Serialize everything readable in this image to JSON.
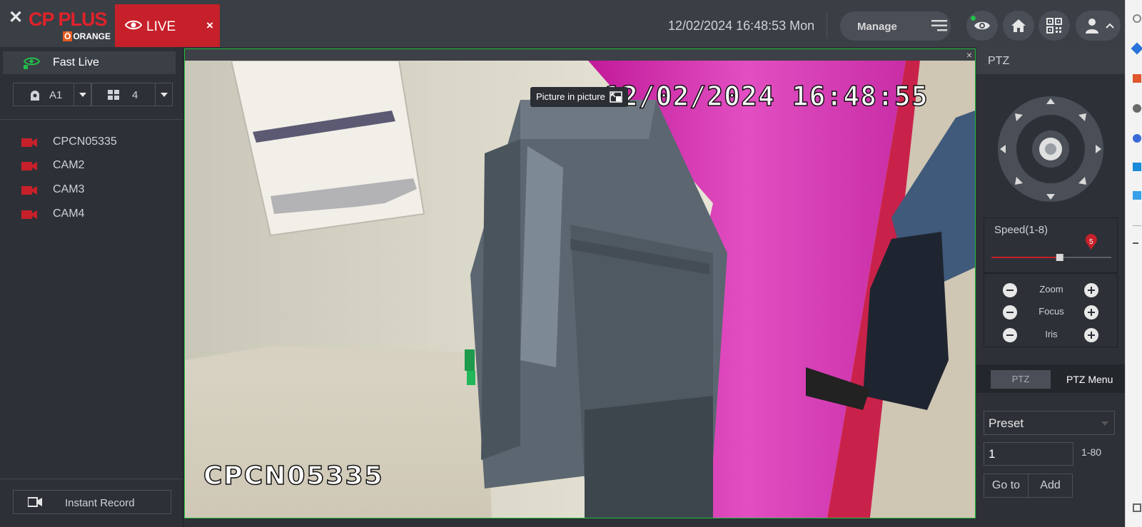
{
  "header": {
    "logo_text": "CP PLUS",
    "logo_sub": "ORANGE",
    "live_tab_label": "LIVE",
    "live_tab_close": "×",
    "datetime": "12/02/2024 16:48:53 Mon",
    "manage_label": "Manage"
  },
  "sidebar": {
    "fast_live_label": "Fast Live",
    "channel_select": "A1",
    "layout_select": "4",
    "cameras": [
      {
        "label": "CPCN05335"
      },
      {
        "label": "CAM2"
      },
      {
        "label": "CAM3"
      },
      {
        "label": "CAM4"
      }
    ],
    "instant_record_label": "Instant Record"
  },
  "video": {
    "close": "×",
    "pip_tooltip": "Picture in picture",
    "osd_time": "12/02/2024 16:48:55",
    "osd_camera_name": "CPCN05335"
  },
  "ptz": {
    "title": "PTZ",
    "speed_label": "Speed(1-8)",
    "speed_value": "5",
    "speed_fraction": 0.57,
    "zoom_label": "Zoom",
    "focus_label": "Focus",
    "iris_label": "Iris",
    "tab_ptz": "PTZ",
    "tab_ptz_menu": "PTZ Menu",
    "preset_label": "Preset",
    "preset_number": "1",
    "preset_range": "1-80",
    "goto_label": "Go to",
    "add_label": "Add"
  },
  "colors": {
    "accent_red": "#c6202a",
    "live_green": "#22c04a"
  }
}
